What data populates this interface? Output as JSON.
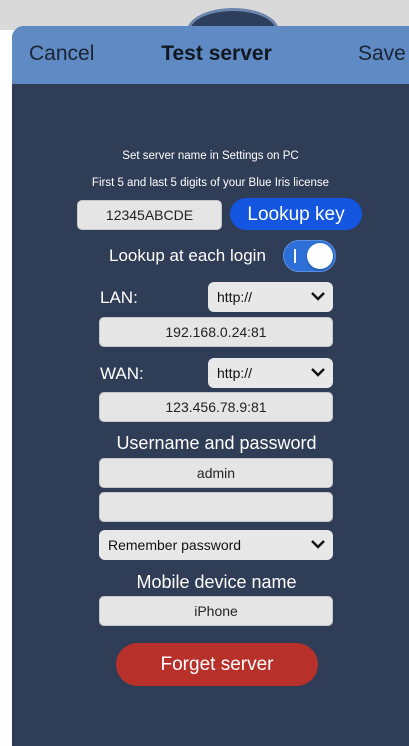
{
  "nav": {
    "cancel_label": "Cancel",
    "title": "Test server",
    "save_label": "Save"
  },
  "hints": {
    "server_name": "Set server name in Settings on PC",
    "license": "First 5 and last 5 digits of your Blue Iris license"
  },
  "license": {
    "value": "12345ABCDE",
    "lookup_button": "Lookup key"
  },
  "lookup_toggle": {
    "label": "Lookup at each login",
    "state": "on"
  },
  "lan": {
    "label": "LAN:",
    "protocol": "http://",
    "address": "192.168.0.24:81"
  },
  "wan": {
    "label": "WAN:",
    "protocol": "http://",
    "address": "123.456.78.9:81"
  },
  "credentials": {
    "heading": "Username and password",
    "username": "admin",
    "password": "",
    "remember_option": "Remember password"
  },
  "device": {
    "heading": "Mobile device name",
    "name": "iPhone"
  },
  "forget_button": "Forget server",
  "colors": {
    "navbar": "#5f8ac4",
    "background": "#2f3d56",
    "accent_blue": "#1456e0",
    "danger_red": "#b7312a"
  }
}
